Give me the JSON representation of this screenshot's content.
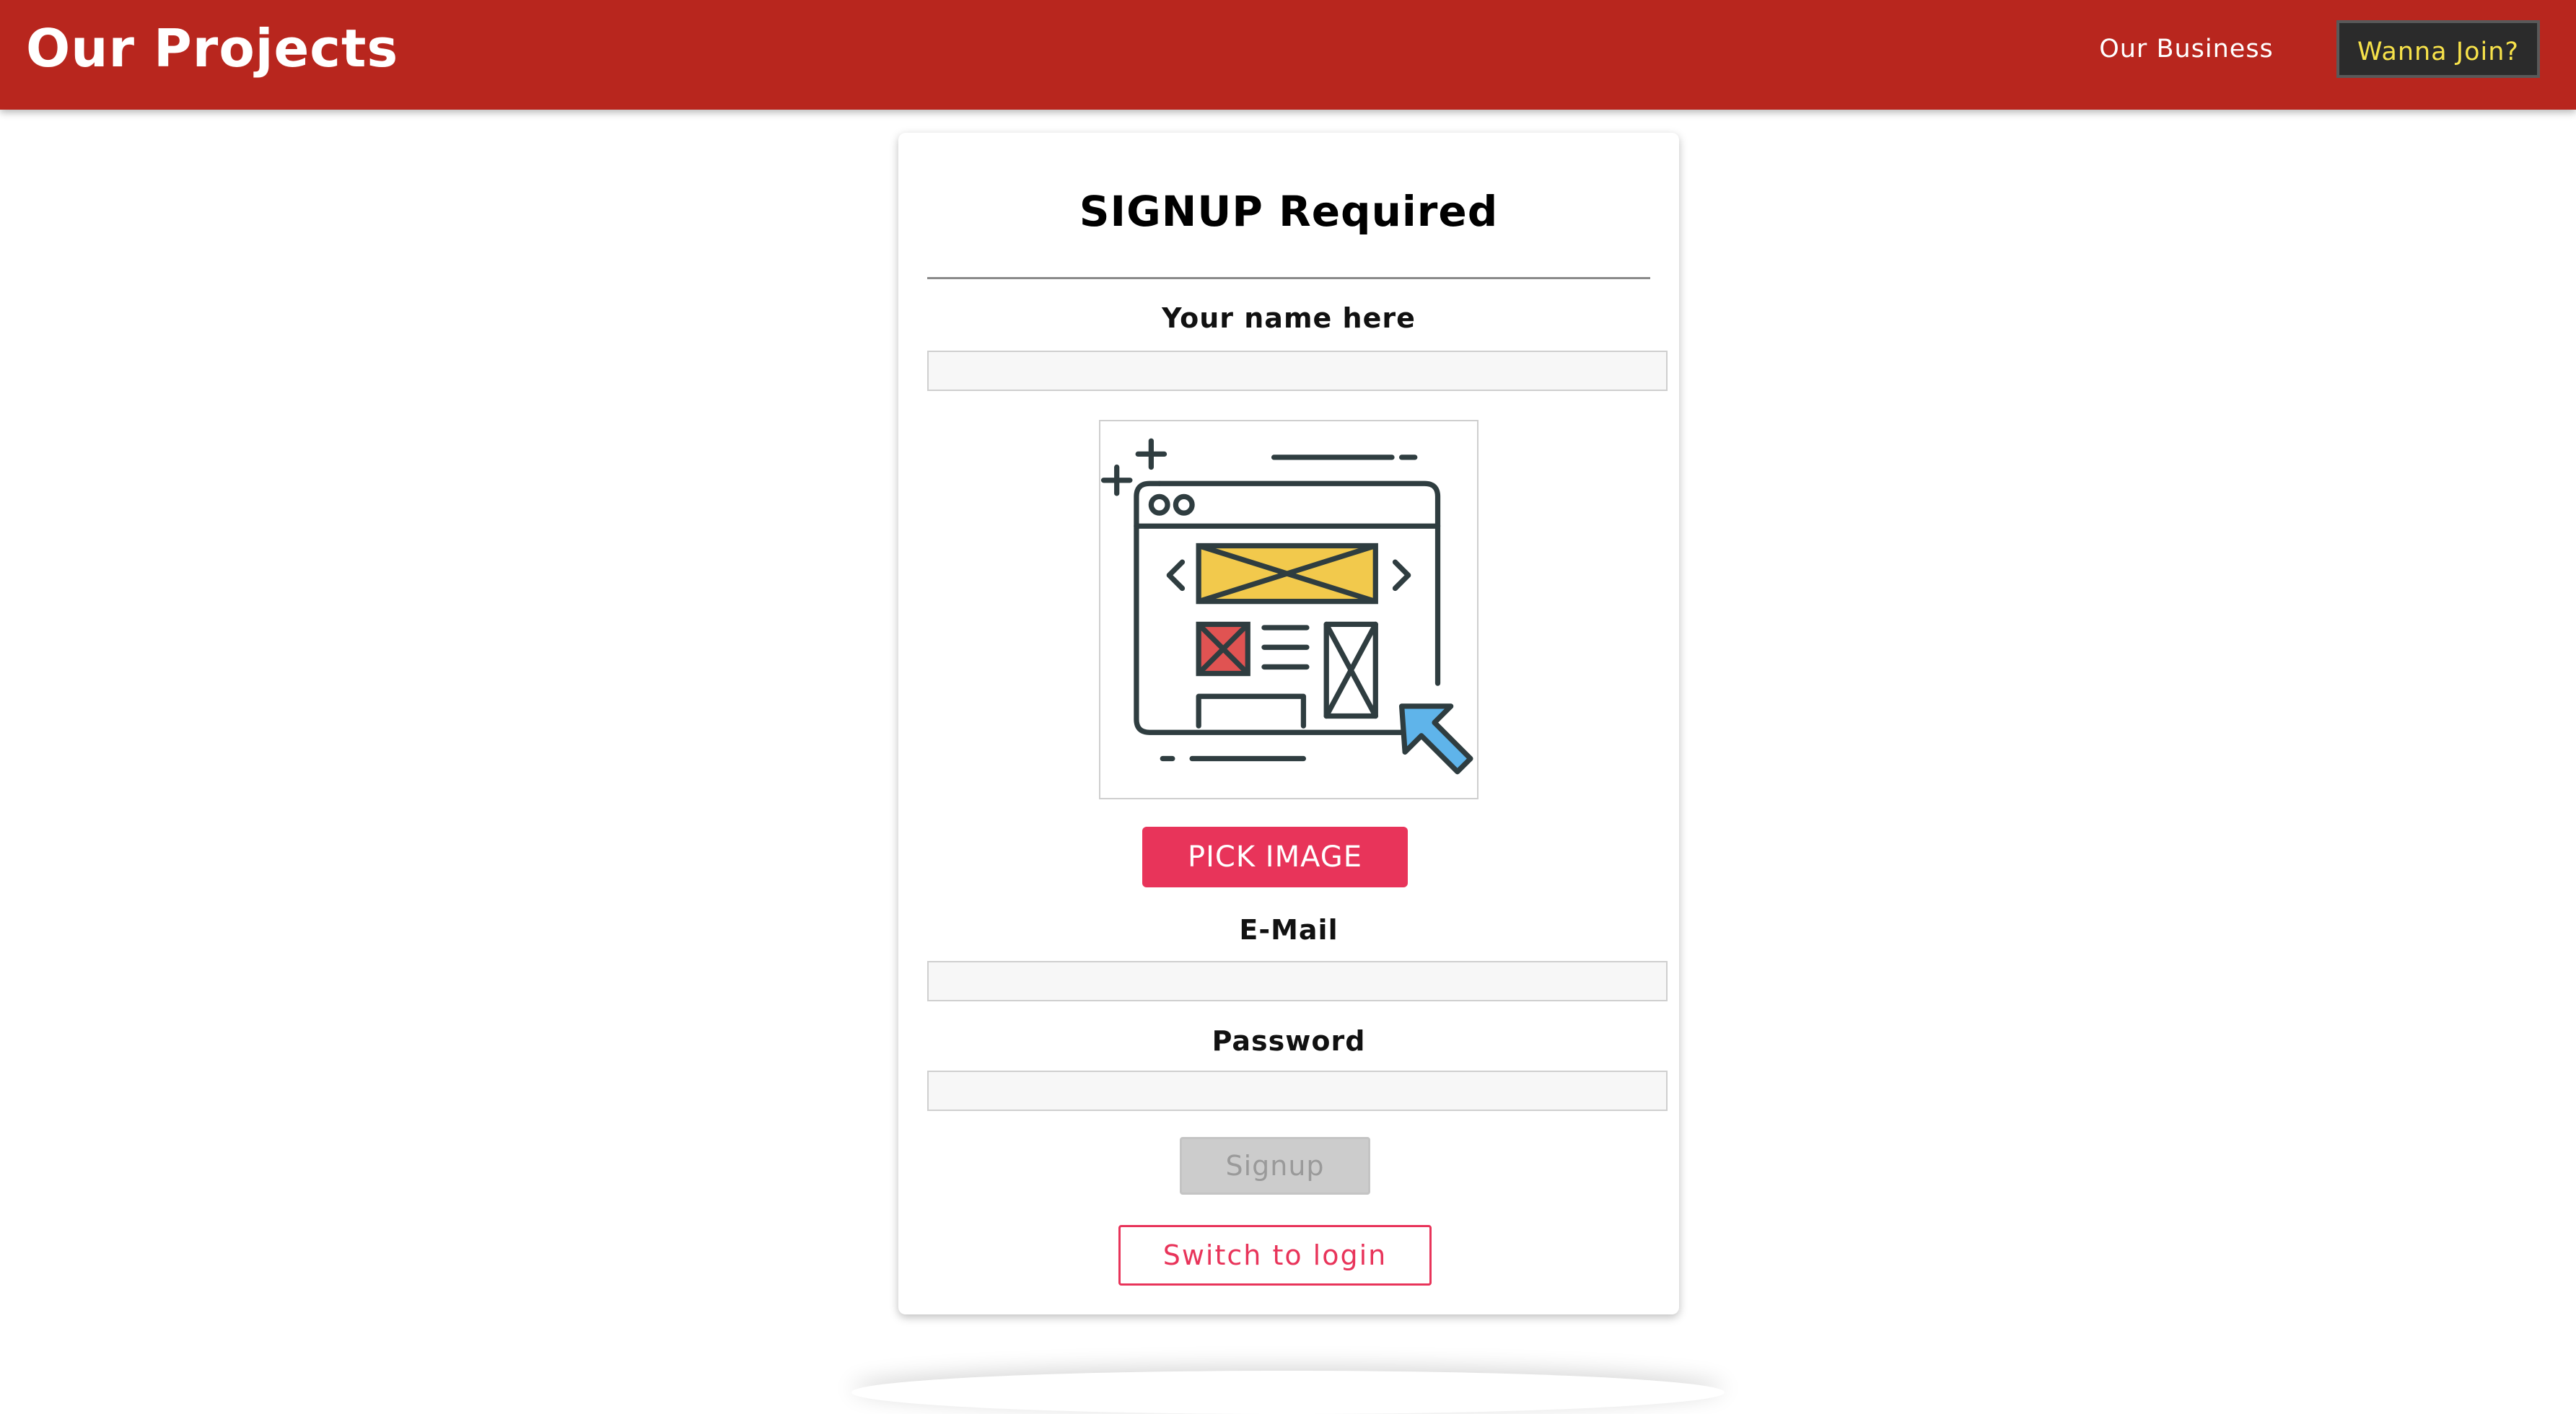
{
  "header": {
    "brand": "Our Projects",
    "nav_link": "Our Business",
    "cta": "Wanna Join?",
    "colors": {
      "background": "#b8261e",
      "cta_text": "#f7e24a",
      "cta_background": "#2b2b2b"
    }
  },
  "form": {
    "title": "SIGNUP Required",
    "name_label": "Your name here",
    "name_value": "",
    "image_icon": "web-design-wireframe-icon",
    "pick_image_label": "PICK IMAGE",
    "email_label": "E-Mail",
    "email_value": "",
    "password_label": "Password",
    "password_value": "",
    "signup_label": "Signup",
    "signup_state": "disabled",
    "switch_label": "Switch to login",
    "colors": {
      "accent": "#e8345a",
      "disabled": "#cccccc"
    }
  }
}
